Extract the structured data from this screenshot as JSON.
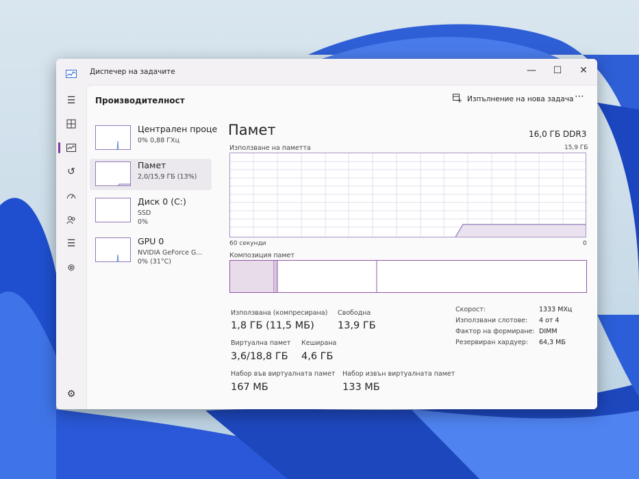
{
  "window": {
    "title": "Диспечер на задачите"
  },
  "header": {
    "page_title": "Производителност",
    "run_task_label": "Изпълнение на нова задача"
  },
  "devices": [
    {
      "name": "Централен проце",
      "sub": "0% 0,88 ГХц",
      "sub2": ""
    },
    {
      "name": "Памет",
      "sub": "2,0/15,9 ГБ (13%)",
      "sub2": ""
    },
    {
      "name": "Диск 0 (C:)",
      "sub": "SSD",
      "sub2": "0%"
    },
    {
      "name": "GPU 0",
      "sub": "NVIDIA GeForce G...",
      "sub2": "0% (31°C)"
    }
  ],
  "detail": {
    "title": "Памет",
    "spec": "16,0 ГБ DDR3",
    "usage_label": "Използване на паметта",
    "usage_max": "15,9 ГБ",
    "graph_left": "60 секунди",
    "graph_right": "0",
    "composition_label": "Композиция памет"
  },
  "stats": {
    "used_label": "Използвана (компресирана)",
    "used_value": "1,8 ГБ (11,5 МБ)",
    "free_label": "Свободна",
    "free_value": "13,9 ГБ",
    "virtual_label": "Виртуална памет",
    "virtual_value": "3,6/18,8 ГБ",
    "cached_label": "Кеширана",
    "cached_value": "4,6 ГБ",
    "paged_label": "Набор във виртуалната памет",
    "paged_value": "167 МБ",
    "nonpaged_label": "Набор извън виртуалната памет",
    "nonpaged_value": "133 МБ"
  },
  "specs": [
    {
      "key": "Скорост:",
      "value": "1333 МХц"
    },
    {
      "key": "Използвани слотове:",
      "value": "4 от 4"
    },
    {
      "key": "Фактор на формиране:",
      "value": "DIMM"
    },
    {
      "key": "Резервиран хардуер:",
      "value": "64,3 МБ"
    }
  ],
  "colors": {
    "accent": "#7b3aa0",
    "graph_line": "#8f77b8",
    "memory_fill": "#e9dcea"
  }
}
